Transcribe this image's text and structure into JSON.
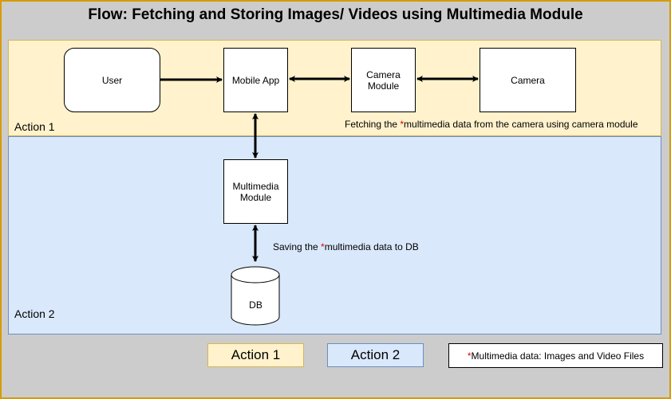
{
  "title": "Flow: Fetching and Storing Images/ Videos using Multimedia Module",
  "lanes": [
    {
      "label": "Action 1",
      "fill": "#fff2cc",
      "stroke": "#d6b656"
    },
    {
      "label": "Action 2",
      "fill": "#dae8fc",
      "stroke": "#6c8ebf"
    }
  ],
  "nodes": {
    "user": "User",
    "mobile_app": "Mobile App",
    "camera_module": "Camera\nModule",
    "camera": "Camera",
    "multimedia_module": "Multimedia\nModule",
    "db": "DB"
  },
  "edges": [
    {
      "from": "user",
      "to": "mobile_app",
      "direction": "forward"
    },
    {
      "from": "mobile_app",
      "to": "camera_module",
      "direction": "both"
    },
    {
      "from": "camera_module",
      "to": "camera",
      "direction": "both"
    },
    {
      "from": "mobile_app",
      "to": "multimedia_module",
      "direction": "both"
    },
    {
      "from": "multimedia_module",
      "to": "db",
      "direction": "both"
    }
  ],
  "captions": {
    "fetch": {
      "prefix": "Fetching the ",
      "star": "*",
      "suffix": "multimedia data from the camera using camera module"
    },
    "save": {
      "prefix": "Saving the ",
      "star": "*",
      "suffix": "multimedia data to DB"
    }
  },
  "legend": {
    "action1": "Action 1",
    "action2": "Action 2",
    "note_star": "*",
    "note_text": "Multimedia data: Images and Video Files"
  },
  "colors": {
    "background": "#cccccc",
    "frame_border": "#d79b00",
    "asterisk": "#e00000"
  }
}
